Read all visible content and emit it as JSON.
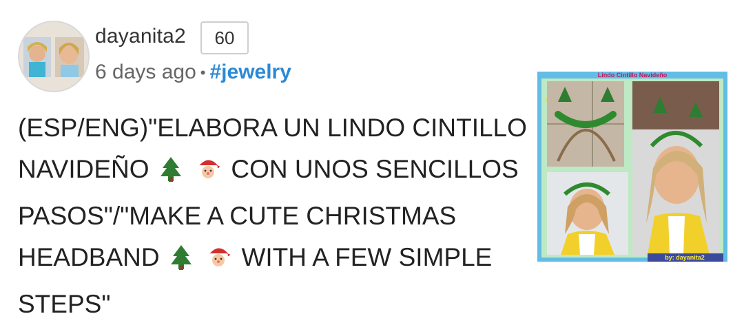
{
  "post": {
    "author": "dayanita2",
    "reputation": "60",
    "time": "6 days ago",
    "separator": "•",
    "tag": "#jewelry",
    "title_line1": "(ESP/ENG)\"ELABORA UN LINDO CINTILLO",
    "title_line2a": "NAVIDEÑO",
    "title_line2b": "CON UNOS SENCILLOS",
    "title_line3": "PASOS\"/\"MAKE A CUTE CHRISTMAS",
    "title_line4a": "HEADBAND",
    "title_line4b": "WITH A FEW SIMPLE",
    "title_line5": "STEPS\""
  },
  "thumbnail": {
    "header_text": "Lindo Cintillo Navideño",
    "credit_text": "by: dayanita2"
  },
  "icons": [
    "christmas-tree-icon",
    "santa-icon"
  ],
  "colors": {
    "tag": "#2b89d6",
    "text": "#222222",
    "meta": "#666666"
  }
}
